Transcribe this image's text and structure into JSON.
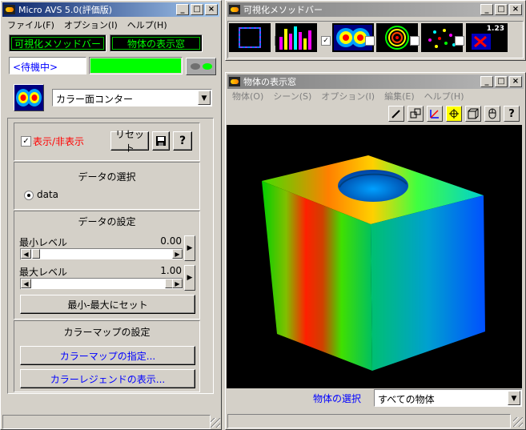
{
  "main_window": {
    "title": "Micro AVS 5.0(評価版)",
    "menu": [
      "ファイル(F)",
      "オプション(I)",
      "ヘルプ(H)"
    ],
    "vis_method_bar_button": "可視化メソッドバー",
    "object_window_button": "物体の表示窓",
    "status_text": "<待機中>",
    "method_select": "カラー面コンター",
    "show_hide_label": "表示/非表示",
    "reset_button": "リセット",
    "help_button": "?",
    "data_select": {
      "title": "データの選択",
      "radio_label": "data"
    },
    "data_settings": {
      "title": "データの設定",
      "min_label": "最小レベル",
      "min_value": "0.00",
      "max_label": "最大レベル",
      "max_value": "1.00",
      "set_button": "最小-最大にセット"
    },
    "colormap": {
      "title": "カラーマップの設定",
      "assign_button": "カラーマップの指定...",
      "legend_button": "カラーレジェンドの表示..."
    }
  },
  "vis_bar_window": {
    "title": "可視化メソッドバー"
  },
  "object_window": {
    "title": "物体の表示窓",
    "menu": [
      "物体(O)",
      "シーン(S)",
      "オプション(I)",
      "編集(E)",
      "ヘルプ(H)"
    ],
    "select_label": "物体の選択",
    "select_value": "すべての物体",
    "toolbar_help": "?"
  },
  "method_icons": [
    {
      "name": "bounds"
    },
    {
      "name": "bar-chart"
    },
    {
      "name": "color-contour"
    },
    {
      "name": "isoline"
    },
    {
      "name": "scatter-points"
    },
    {
      "name": "numeric-label",
      "text": "1.23"
    }
  ],
  "colors": {
    "title_active": "#0a246a",
    "title_inactive": "#808080",
    "status_green": "#00ff00",
    "text_blue": "#0000ff",
    "text_red": "#ff0000"
  }
}
